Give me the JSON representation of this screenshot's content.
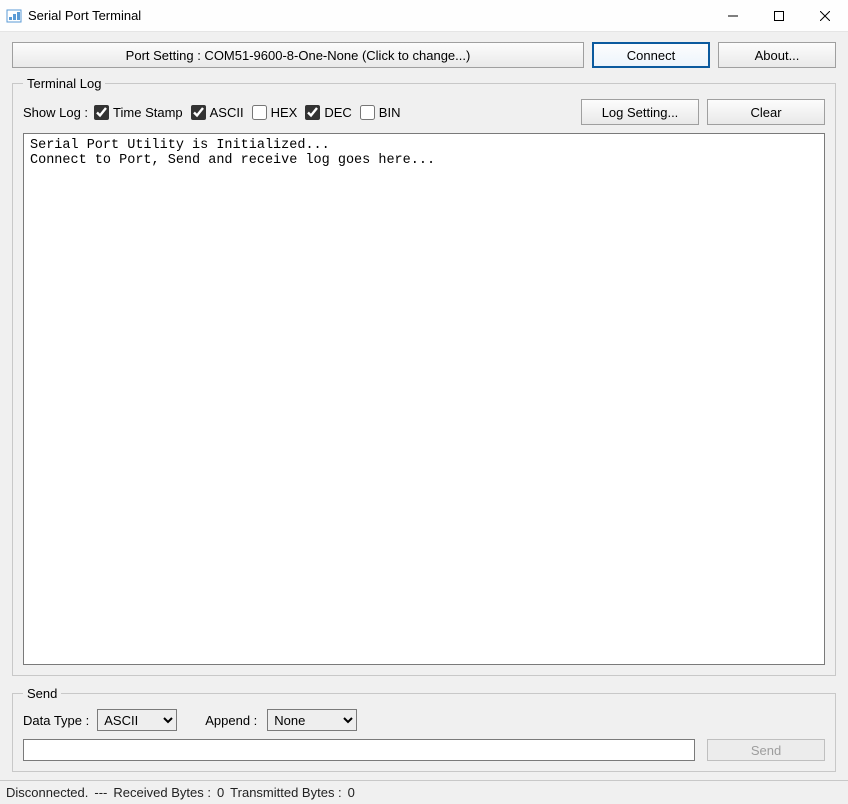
{
  "window": {
    "title": "Serial Port Terminal"
  },
  "toolbar": {
    "port_label": "Port Setting : COM51-9600-8-One-None (Click to change...)",
    "connect_label": "Connect",
    "about_label": "About..."
  },
  "terminal_log": {
    "legend": "Terminal Log",
    "showlog_label": "Show Log :",
    "checkboxes": {
      "timestamp": {
        "label": "Time Stamp",
        "checked": true
      },
      "ascii": {
        "label": "ASCII",
        "checked": true
      },
      "hex": {
        "label": "HEX",
        "checked": false
      },
      "dec": {
        "label": "DEC",
        "checked": true
      },
      "bin": {
        "label": "BIN",
        "checked": false
      }
    },
    "log_setting_label": "Log Setting...",
    "clear_label": "Clear",
    "log_content": "Serial Port Utility is Initialized...\nConnect to Port, Send and receive log goes here..."
  },
  "send": {
    "legend": "Send",
    "datatype_label": "Data Type :",
    "datatype_value": "ASCII",
    "append_label": "Append :",
    "append_value": "None",
    "send_label": "Send",
    "input_value": ""
  },
  "status": {
    "connection": "Disconnected.",
    "separator": "---",
    "recv_label": "Received Bytes :",
    "recv_value": "0",
    "xmit_label": "Transmitted Bytes :",
    "xmit_value": "0"
  }
}
